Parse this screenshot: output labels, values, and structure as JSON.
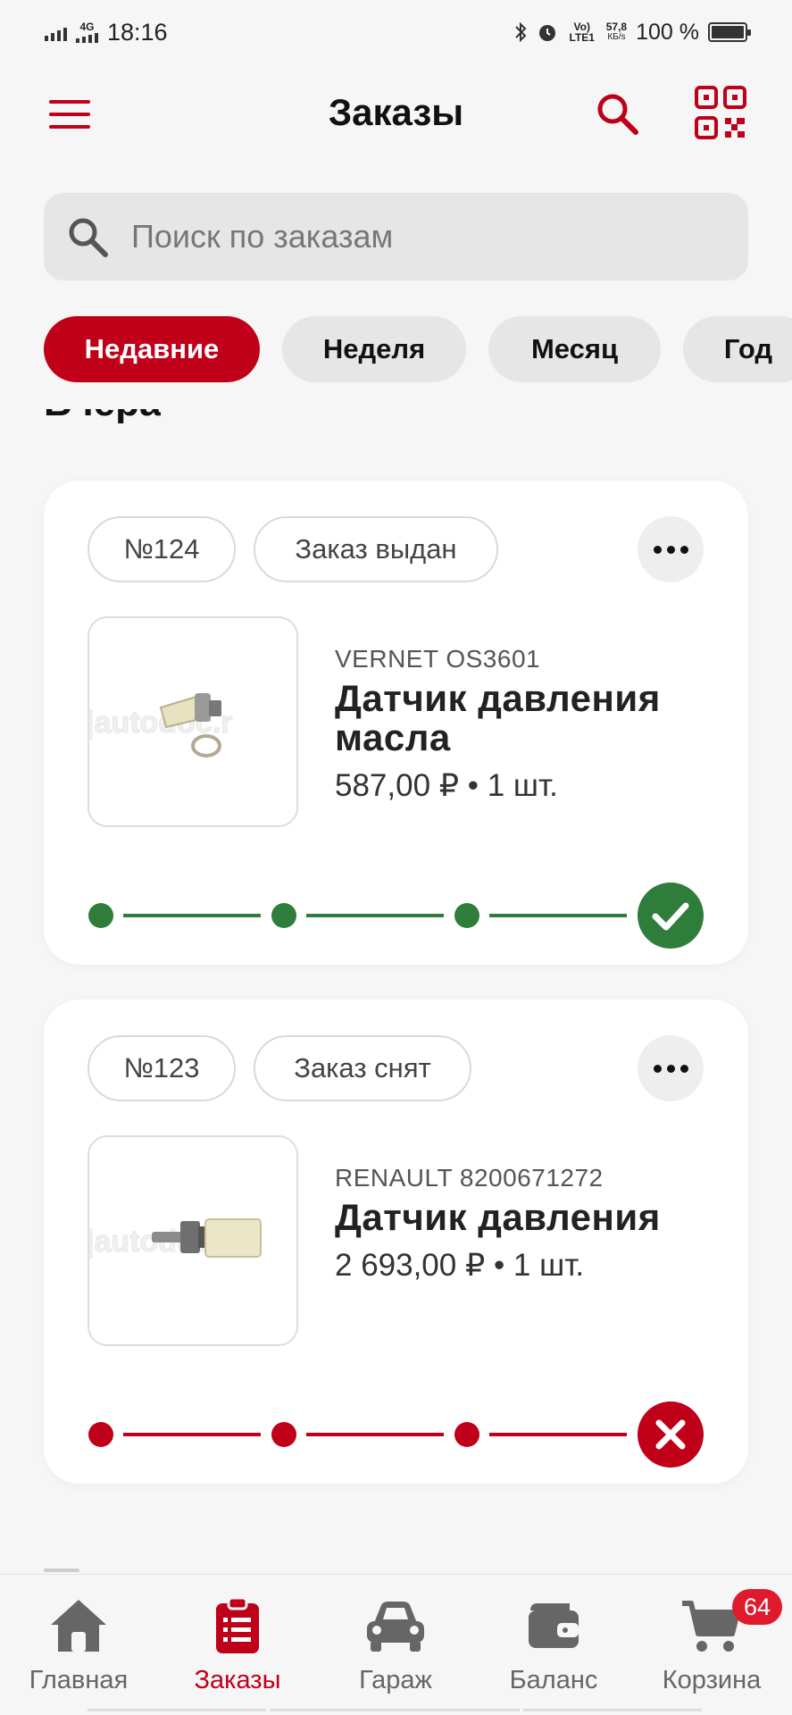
{
  "status_bar": {
    "network": "4G",
    "time": "18:16",
    "volte": "Vo) LTE1",
    "speed": "57,8",
    "speed_unit": "КБ/s",
    "battery": "100 %"
  },
  "header": {
    "title": "Заказы",
    "icons": [
      "menu-icon",
      "search-icon",
      "qr-code-icon"
    ]
  },
  "search": {
    "placeholder": "Поиск по заказам"
  },
  "filters": [
    {
      "label": "Недавние",
      "active": true
    },
    {
      "label": "Неделя",
      "active": false
    },
    {
      "label": "Месяц",
      "active": false
    },
    {
      "label": "Год",
      "active": false
    }
  ],
  "section_title": "Вчера",
  "orders": [
    {
      "number": "№124",
      "status": "Заказ выдан",
      "brand": "VERNET OS3601",
      "name": "Датчик давления масла",
      "price": "587,00 ₽ • 1 шт.",
      "progress_steps_done": 4,
      "result": "success",
      "color": "#2e7d3a"
    },
    {
      "number": "№123",
      "status": "Заказ снят",
      "brand": "RENAULT 8200671272",
      "name": "Датчик давления",
      "price": "2 693,00 ₽ • 1 шт.",
      "progress_steps_done": 4,
      "result": "cancelled",
      "color": "#c00018"
    }
  ],
  "bottom_nav": [
    {
      "label": "Главная",
      "icon": "home-icon",
      "active": false
    },
    {
      "label": "Заказы",
      "icon": "orders-icon",
      "active": true
    },
    {
      "label": "Гараж",
      "icon": "car-icon",
      "active": false
    },
    {
      "label": "Баланс",
      "icon": "wallet-icon",
      "active": false
    },
    {
      "label": "Корзина",
      "icon": "cart-icon",
      "active": false,
      "badge": "64"
    }
  ],
  "colors": {
    "accent": "#c00018",
    "success": "#2e7d3a",
    "background": "#f6f6f6"
  }
}
